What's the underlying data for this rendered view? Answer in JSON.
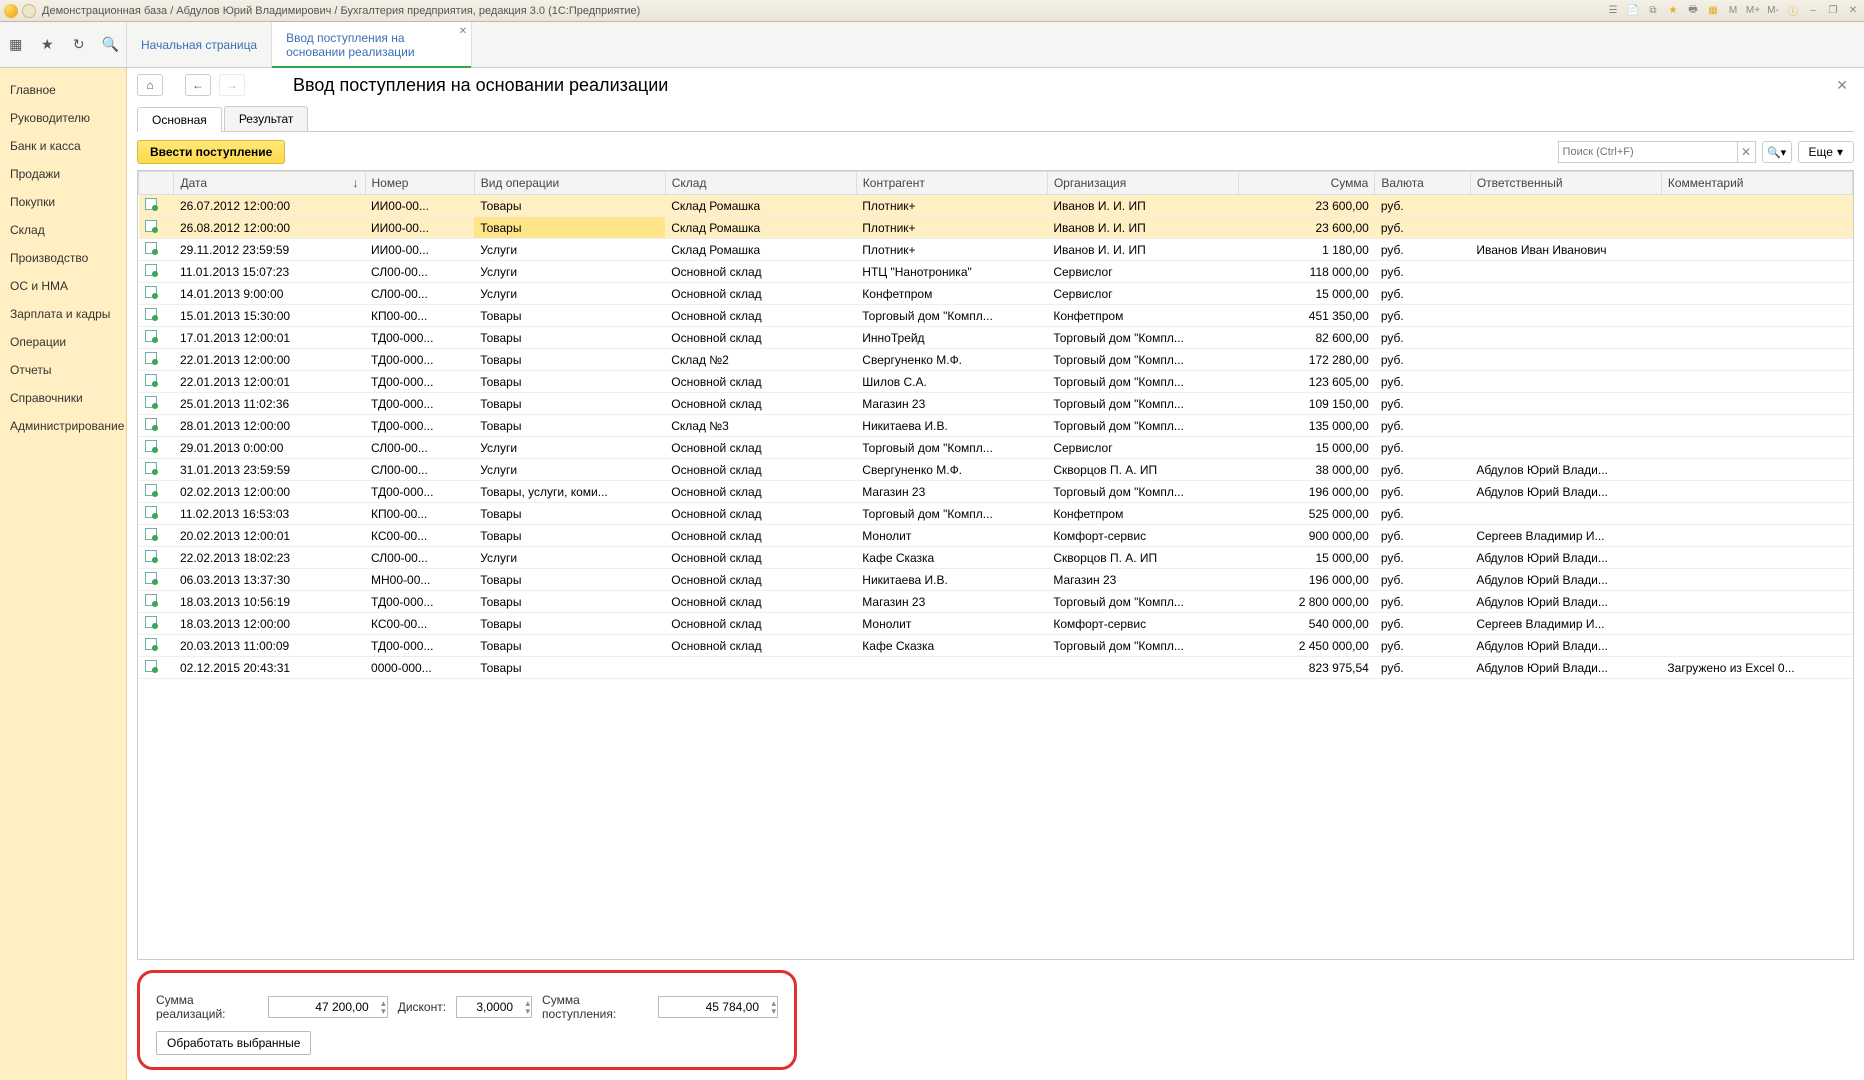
{
  "titlebar": "Демонстрационная база / Абдулов Юрий Владимирович / Бухгалтерия предприятия, редакция 3.0  (1С:Предприятие)",
  "tb_icons": [
    "M",
    "M+",
    "M-",
    "i",
    "–",
    "❐",
    "✕"
  ],
  "tabs": {
    "start": "Начальная страница",
    "active": "Ввод поступления на основании реализации"
  },
  "sidebar": [
    "Главное",
    "Руководителю",
    "Банк и касса",
    "Продажи",
    "Покупки",
    "Склад",
    "Производство",
    "ОС и НМА",
    "Зарплата и кадры",
    "Операции",
    "Отчеты",
    "Справочники",
    "Администрирование"
  ],
  "page_title": "Ввод поступления на основании реализации",
  "inner_tabs": {
    "main": "Основная",
    "result": "Результат"
  },
  "btn_enter": "Ввести поступление",
  "search_placeholder": "Поиск (Ctrl+F)",
  "btn_more": "Еще",
  "columns": [
    "",
    "Дата",
    "Номер",
    "Вид операции",
    "Склад",
    "Контрагент",
    "Организация",
    "Сумма",
    "Валюта",
    "Ответственный",
    "Комментарий"
  ],
  "rows": [
    {
      "sel": 1,
      "date": "26.07.2012 12:00:00",
      "num": "ИИ00-00...",
      "op": "Товары",
      "store": "Склад Ромашка",
      "contr": "Плотник+",
      "org": "Иванов И. И. ИП",
      "sum": "23 600,00",
      "cur": "руб.",
      "resp": "",
      "comm": ""
    },
    {
      "sel": 1,
      "hl": 1,
      "date": "26.08.2012 12:00:00",
      "num": "ИИ00-00...",
      "op": "Товары",
      "store": "Склад Ромашка",
      "contr": "Плотник+",
      "org": "Иванов И. И. ИП",
      "sum": "23 600,00",
      "cur": "руб.",
      "resp": "",
      "comm": ""
    },
    {
      "date": "29.11.2012 23:59:59",
      "num": "ИИ00-00...",
      "op": "Услуги",
      "store": "Склад Ромашка",
      "contr": "Плотник+",
      "org": "Иванов И. И. ИП",
      "sum": "1 180,00",
      "cur": "руб.",
      "resp": "Иванов Иван Иванович",
      "comm": ""
    },
    {
      "date": "11.01.2013 15:07:23",
      "num": "СЛ00-00...",
      "op": "Услуги",
      "store": "Основной склад",
      "contr": "НТЦ \"Нанотроника\"",
      "org": "Сервислог",
      "sum": "118 000,00",
      "cur": "руб.",
      "resp": "",
      "comm": ""
    },
    {
      "date": "14.01.2013 9:00:00",
      "num": "СЛ00-00...",
      "op": "Услуги",
      "store": "Основной склад",
      "contr": "Конфетпром",
      "org": "Сервислог",
      "sum": "15 000,00",
      "cur": "руб.",
      "resp": "",
      "comm": ""
    },
    {
      "date": "15.01.2013 15:30:00",
      "num": "КП00-00...",
      "op": "Товары",
      "store": "Основной склад",
      "contr": "Торговый дом \"Компл...",
      "org": "Конфетпром",
      "sum": "451 350,00",
      "cur": "руб.",
      "resp": "",
      "comm": ""
    },
    {
      "date": "17.01.2013 12:00:01",
      "num": "ТД00-000...",
      "op": "Товары",
      "store": "Основной склад",
      "contr": "ИнноТрейд",
      "org": "Торговый дом \"Компл...",
      "sum": "82 600,00",
      "cur": "руб.",
      "resp": "",
      "comm": ""
    },
    {
      "date": "22.01.2013 12:00:00",
      "num": "ТД00-000...",
      "op": "Товары",
      "store": "Склад №2",
      "contr": "Свергуненко М.Ф.",
      "org": "Торговый дом \"Компл...",
      "sum": "172 280,00",
      "cur": "руб.",
      "resp": "",
      "comm": ""
    },
    {
      "date": "22.01.2013 12:00:01",
      "num": "ТД00-000...",
      "op": "Товары",
      "store": "Основной склад",
      "contr": "Шилов С.А.",
      "org": "Торговый дом \"Компл...",
      "sum": "123 605,00",
      "cur": "руб.",
      "resp": "",
      "comm": ""
    },
    {
      "date": "25.01.2013 11:02:36",
      "num": "ТД00-000...",
      "op": "Товары",
      "store": "Основной склад",
      "contr": "Магазин 23",
      "org": "Торговый дом \"Компл...",
      "sum": "109 150,00",
      "cur": "руб.",
      "resp": "",
      "comm": ""
    },
    {
      "date": "28.01.2013 12:00:00",
      "num": "ТД00-000...",
      "op": "Товары",
      "store": "Склад №3",
      "contr": "Никитаева И.В.",
      "org": "Торговый дом \"Компл...",
      "sum": "135 000,00",
      "cur": "руб.",
      "resp": "",
      "comm": ""
    },
    {
      "date": "29.01.2013 0:00:00",
      "num": "СЛ00-00...",
      "op": "Услуги",
      "store": "Основной склад",
      "contr": "Торговый дом \"Компл...",
      "org": "Сервислог",
      "sum": "15 000,00",
      "cur": "руб.",
      "resp": "",
      "comm": ""
    },
    {
      "date": "31.01.2013 23:59:59",
      "num": "СЛ00-00...",
      "op": "Услуги",
      "store": "Основной склад",
      "contr": "Свергуненко М.Ф.",
      "org": "Скворцов П. А. ИП",
      "sum": "38 000,00",
      "cur": "руб.",
      "resp": "Абдулов Юрий Влади...",
      "comm": ""
    },
    {
      "date": "02.02.2013 12:00:00",
      "num": "ТД00-000...",
      "op": "Товары, услуги, коми...",
      "store": "Основной склад",
      "contr": "Магазин 23",
      "org": "Торговый дом \"Компл...",
      "sum": "196 000,00",
      "cur": "руб.",
      "resp": "Абдулов Юрий Влади...",
      "comm": ""
    },
    {
      "date": "11.02.2013 16:53:03",
      "num": "КП00-00...",
      "op": "Товары",
      "store": "Основной склад",
      "contr": "Торговый дом \"Компл...",
      "org": "Конфетпром",
      "sum": "525 000,00",
      "cur": "руб.",
      "resp": "",
      "comm": ""
    },
    {
      "date": "20.02.2013 12:00:01",
      "num": "КС00-00...",
      "op": "Товары",
      "store": "Основной склад",
      "contr": "Монолит",
      "org": "Комфорт-сервис",
      "sum": "900 000,00",
      "cur": "руб.",
      "resp": "Сергеев Владимир И...",
      "comm": ""
    },
    {
      "date": "22.02.2013 18:02:23",
      "num": "СЛ00-00...",
      "op": "Услуги",
      "store": "Основной склад",
      "contr": "Кафе Сказка",
      "org": "Скворцов П. А. ИП",
      "sum": "15 000,00",
      "cur": "руб.",
      "resp": "Абдулов Юрий Влади...",
      "comm": ""
    },
    {
      "date": "06.03.2013 13:37:30",
      "num": "МН00-00...",
      "op": "Товары",
      "store": "Основной склад",
      "contr": "Никитаева И.В.",
      "org": "Магазин 23",
      "sum": "196 000,00",
      "cur": "руб.",
      "resp": "Абдулов Юрий Влади...",
      "comm": ""
    },
    {
      "date": "18.03.2013 10:56:19",
      "num": "ТД00-000...",
      "op": "Товары",
      "store": "Основной склад",
      "contr": "Магазин 23",
      "org": "Торговый дом \"Компл...",
      "sum": "2 800 000,00",
      "cur": "руб.",
      "resp": "Абдулов Юрий Влади...",
      "comm": ""
    },
    {
      "date": "18.03.2013 12:00:00",
      "num": "КС00-00...",
      "op": "Товары",
      "store": "Основной склад",
      "contr": "Монолит",
      "org": "Комфорт-сервис",
      "sum": "540 000,00",
      "cur": "руб.",
      "resp": "Сергеев Владимир И...",
      "comm": ""
    },
    {
      "date": "20.03.2013 11:00:09",
      "num": "ТД00-000...",
      "op": "Товары",
      "store": "Основной склад",
      "contr": "Кафе Сказка",
      "org": "Торговый дом \"Компл...",
      "sum": "2 450 000,00",
      "cur": "руб.",
      "resp": "Абдулов Юрий Влади...",
      "comm": ""
    },
    {
      "date": "02.12.2015 20:43:31",
      "num": "0000-000...",
      "op": "Товары",
      "store": "",
      "contr": "",
      "org": "",
      "sum": "823 975,54",
      "cur": "руб.",
      "resp": "Абдулов Юрий Влади...",
      "comm": "Загружено из Excel 0..."
    }
  ],
  "footer": {
    "sum_label": "Сумма реализаций:",
    "sum_val": "47 200,00",
    "discount_label": "Дисконт:",
    "discount_val": "3,0000",
    "receipt_label": "Сумма поступления:",
    "receipt_val": "45 784,00",
    "btn": "Обработать выбранные"
  }
}
